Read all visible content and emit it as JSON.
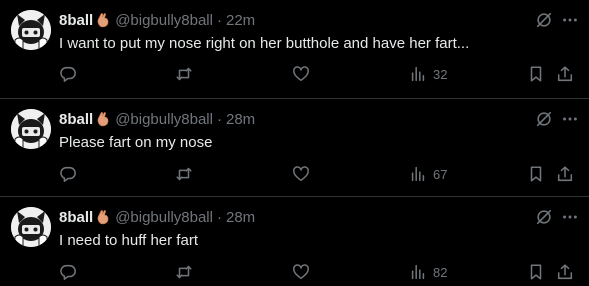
{
  "posts": [
    {
      "display_name": "8ball",
      "handle": "@bigbully8ball",
      "separator": "·",
      "time": "22m",
      "text": "I want to put my nose right on her butthole and have her fart...",
      "views": "32"
    },
    {
      "display_name": "8ball",
      "handle": "@bigbully8ball",
      "separator": "·",
      "time": "28m",
      "text": "Please fart on my nose",
      "views": "67"
    },
    {
      "display_name": "8ball",
      "handle": "@bigbully8ball",
      "separator": "·",
      "time": "28m",
      "text": "I need to huff her fart",
      "views": "82"
    }
  ],
  "icons": {
    "badge": "pinched-hand-emoji",
    "grok": "grok-icon",
    "more": "more-icon",
    "reply": "reply-icon",
    "repost": "repost-icon",
    "like": "heart-icon",
    "views": "views-icon",
    "bookmark": "bookmark-icon",
    "share": "share-icon"
  },
  "colors": {
    "background": "#000000",
    "text": "#e7e9ea",
    "muted": "#71767b",
    "divider": "#2f3336",
    "badge": "#e2a07a"
  }
}
